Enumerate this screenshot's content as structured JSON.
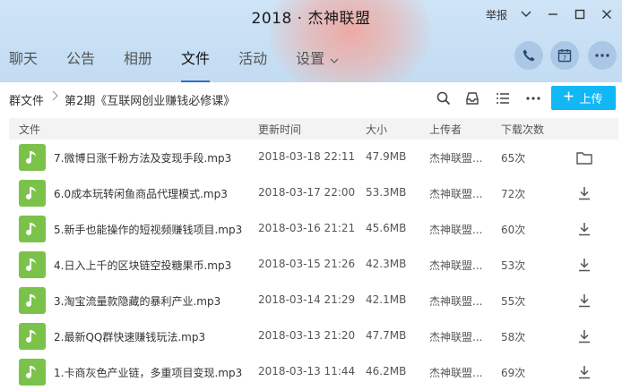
{
  "window": {
    "title": "2018 · 杰神联盟",
    "report_label": "举报"
  },
  "tabs": [
    {
      "label": "聊天"
    },
    {
      "label": "公告"
    },
    {
      "label": "相册"
    },
    {
      "label": "文件",
      "active": true
    },
    {
      "label": "活动"
    },
    {
      "label": "设置"
    }
  ],
  "breadcrumb": {
    "root": "群文件",
    "current": "第2期《互联网创业赚钱必修课》"
  },
  "upload_label": "上传",
  "table": {
    "columns": [
      "文件",
      "更新时间",
      "大小",
      "上传者",
      "下载次数"
    ],
    "rows": [
      {
        "name": "7.微博日涨千粉方法及变现手段.mp3",
        "time": "2018-03-18 22:11",
        "size": "47.9MB",
        "uploader": "杰神联盟...",
        "downloads": "65次",
        "action": "folder-icon"
      },
      {
        "name": "6.0成本玩转闲鱼商品代理模式.mp3",
        "time": "2018-03-17 22:00",
        "size": "53.3MB",
        "uploader": "杰神联盟...",
        "downloads": "72次",
        "action": "download-icon"
      },
      {
        "name": "5.新手也能操作的短视频赚钱项目.mp3",
        "time": "2018-03-16 21:21",
        "size": "45.6MB",
        "uploader": "杰神联盟...",
        "downloads": "60次",
        "action": "download-icon"
      },
      {
        "name": "4.日入上千的区块链空投糖果币.mp3",
        "time": "2018-03-15 21:26",
        "size": "42.3MB",
        "uploader": "杰神联盟...",
        "downloads": "53次",
        "action": "download-icon"
      },
      {
        "name": "3.淘宝流量款隐藏的暴利产业.mp3",
        "time": "2018-03-14 21:29",
        "size": "42.1MB",
        "uploader": "杰神联盟...",
        "downloads": "55次",
        "action": "download-icon"
      },
      {
        "name": "2.最新QQ群快速赚钱玩法.mp3",
        "time": "2018-03-13 21:20",
        "size": "47.7MB",
        "uploader": "杰神联盟...",
        "downloads": "58次",
        "action": "download-icon"
      },
      {
        "name": "1.卡商灰色产业链，多重项目变现.mp3",
        "time": "2018-03-13 11:44",
        "size": "46.2MB",
        "uploader": "杰神联盟...",
        "downloads": "69次",
        "action": "download-icon"
      }
    ]
  },
  "colors": {
    "accent": "#12b7f5",
    "file_icon": "#7bc24a",
    "tab_underline": "#2a6fd0"
  }
}
